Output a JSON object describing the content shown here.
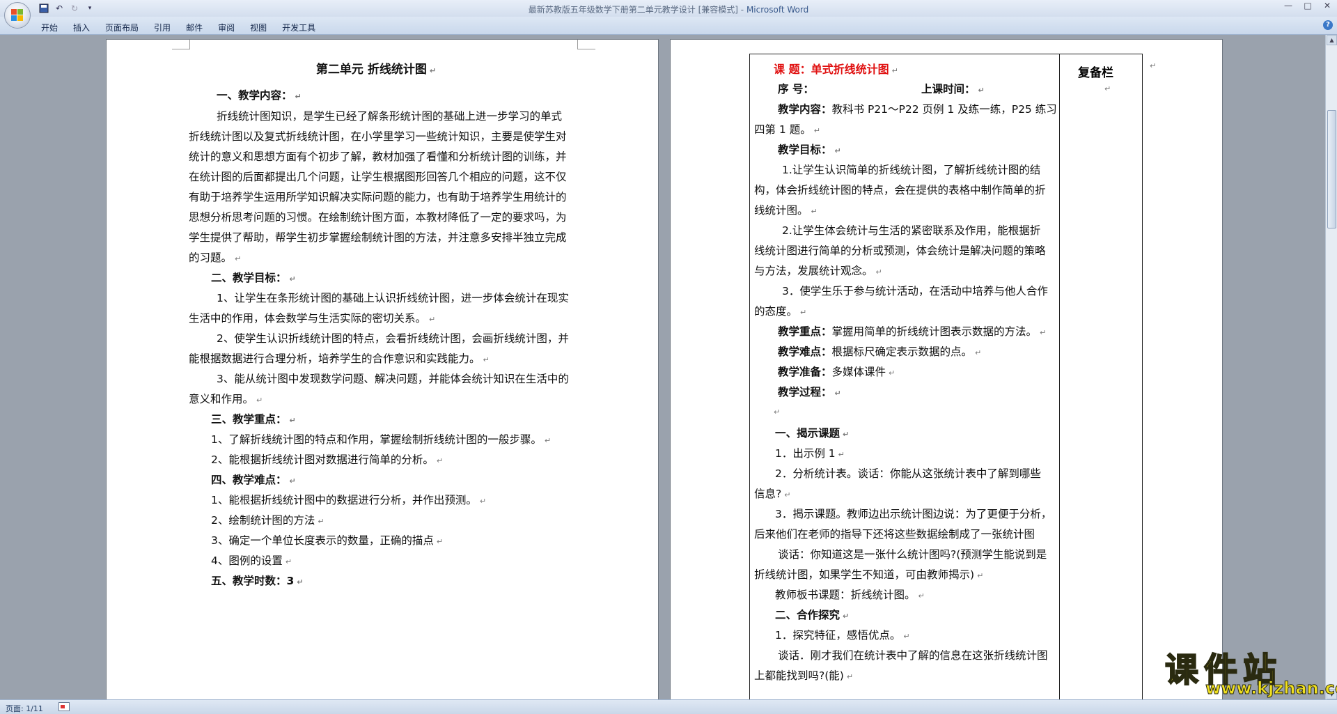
{
  "window": {
    "title": "最新苏教版五年级数学下册第二单元教学设计 [兼容模式]",
    "app_name": "Microsoft Word",
    "controls": {
      "minimize": "—",
      "maximize": "□",
      "close": "✕"
    }
  },
  "quick_access": {
    "save_icon": "▪",
    "undo_icon": "↶",
    "redo_icon": "↻",
    "more_icon": "▾"
  },
  "ribbon": {
    "tabs": [
      "开始",
      "插入",
      "页面布局",
      "引用",
      "邮件",
      "审阅",
      "视图",
      "开发工具"
    ],
    "help": "?"
  },
  "page1": {
    "title": "第二单元  折线统计图",
    "lines": [
      "一、教学内容：",
      "折线统计图知识，是学生已经了解条形统计图的基础上进一步学习的单式",
      "折线统计图以及复式折线统计图，在小学里学习一些统计知识，主要是使学生对",
      "统计的意义和思想方面有个初步了解，教材加强了看懂和分析统计图的训练，并",
      "在统计图的后面都提出几个问题，让学生根据图形回答几个相应的问题，这不仅",
      "有助于培养学生运用所学知识解决实际问题的能力，也有助于培养学生用统计的",
      "思想分析思考问题的习惯。在绘制统计图方面，本教材降低了一定的要求吗，为",
      "学生提供了帮助，帮学生初步掌握绘制统计图的方法，并注意多安排半独立完成",
      "的习题。",
      "二、教学目标：",
      "1、让学生在条形统计图的基础上认识折线统计图，进一步体会统计在现实",
      "生活中的作用，体会数学与生活实际的密切关系。",
      "2、使学生认识折线统计图的特点，会看折线统计图，会画折线统计图，并",
      "能根据数据进行合理分析，培养学生的合作意识和实践能力。",
      "3、能从统计图中发现数学问题、解决问题，并能体会统计知识在生活中的",
      "意义和作用。",
      "三、教学重点：",
      "1、了解折线统计图的特点和作用，掌握绘制折线统计图的一般步骤。",
      "2、能根据折线统计图对数据进行简单的分析。",
      "四、教学难点：",
      "1、能根据折线统计图中的数据进行分析，并作出预测。",
      "2、绘制统计图的方法",
      "3、确定一个单位长度表示的数量，正确的描点",
      "4、图例的设置",
      "五、教学时数：3"
    ]
  },
  "page2": {
    "topic_label": "课    题：",
    "topic_value": "单式折线统计图",
    "beibei": "复备栏",
    "lines": [
      "序    号：",
      "上课时间：",
      "教学内容：",
      "教科书 P21～P22 页例 1 及练一练，P25 练习",
      "四第 1 题。",
      "教学目标：",
      "1.让学生认识简单的折线统计图，了解折线统计图的结",
      "构，体会折线统计图的特点，会在提供的表格中制作简单的折",
      "线统计图。",
      "2.让学生体会统计与生活的紧密联系及作用，能根据折",
      "线统计图进行简单的分析或预测，体会统计是解决问题的策略",
      "与方法，发展统计观念。",
      "3．使学生乐于参与统计活动，在活动中培养与他人合作",
      "的态度。",
      "教学重点：",
      "掌握用简单的折线统计图表示数据的方法。",
      "教学难点：",
      "根据标尺确定表示数据的点。",
      "教学准备：",
      "多媒体课件",
      "教学过程：",
      "一、揭示课题",
      "1．出示例 1",
      "2．分析统计表。谈话：你能从这张统计表中了解到哪些",
      "信息?",
      "3．揭示课题。教师边出示统计图边说：为了更便于分析，",
      "后来他们在老师的指导下还将这些数据绘制成了一张统计图",
      "谈话：你知道这是一张什么统计图吗?(预测学生能说到是",
      "折线统计图，如果学生不知道，可由教师揭示)",
      "教师板书课题：折线统计图。",
      "二、合作探究",
      "1．探究特征，感悟优点。",
      "谈话．刚才我们在统计表中了解的信息在这张折线统计图",
      "上都能找到吗?(能)"
    ]
  },
  "scrollbar": {
    "up": "▲",
    "down": "▼"
  },
  "status": {
    "page": "页面: 1/11"
  },
  "watermark": {
    "text": "课件站",
    "url": "www.kjzhan.com"
  }
}
